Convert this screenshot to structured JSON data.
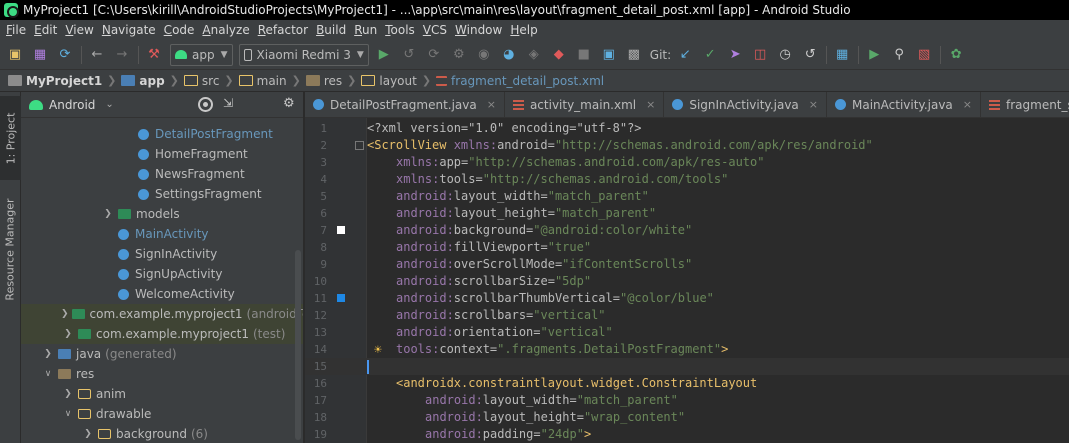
{
  "window": {
    "title": "MyProject1 [C:\\Users\\kirill\\AndroidStudioProjects\\MyProject1] - ...\\app\\src\\main\\res\\layout\\fragment_detail_post.xml [app] - Android Studio"
  },
  "menu": [
    "File",
    "Edit",
    "View",
    "Navigate",
    "Code",
    "Analyze",
    "Refactor",
    "Build",
    "Run",
    "Tools",
    "VCS",
    "Window",
    "Help"
  ],
  "toolbar": {
    "config": "app",
    "device": "Xiaomi Redmi 3",
    "git_label": "Git:"
  },
  "breadcrumb": [
    "MyProject1",
    "app",
    "src",
    "main",
    "res",
    "layout",
    "fragment_detail_post.xml"
  ],
  "side_tabs": {
    "project": "1: Project",
    "resource_manager": "Resource Manager"
  },
  "project_panel": {
    "view": "Android",
    "tree": [
      {
        "label": "DetailPostFragment",
        "icon": "kotlin-class-icon",
        "color": "#6897bb",
        "indent": 100
      },
      {
        "label": "HomeFragment",
        "icon": "kotlin-class-icon",
        "indent": 100
      },
      {
        "label": "NewsFragment",
        "icon": "kotlin-class-icon",
        "indent": 100
      },
      {
        "label": "SettingsFragment",
        "icon": "kotlin-class-icon",
        "indent": 100
      },
      {
        "label": "models",
        "icon": "package-folder-icon",
        "indent": 80,
        "arrow": "right"
      },
      {
        "label": "MainActivity",
        "icon": "kotlin-class-icon",
        "color": "#6897bb",
        "indent": 80
      },
      {
        "label": "SignInActivity",
        "icon": "kotlin-class-icon",
        "indent": 80
      },
      {
        "label": "SignUpActivity",
        "icon": "kotlin-class-icon",
        "indent": 80
      },
      {
        "label": "WelcomeActivity",
        "icon": "kotlin-class-icon",
        "indent": 80
      },
      {
        "label": "com.example.myproject1",
        "suffix": "(androidTest)",
        "icon": "package-folder-icon",
        "indent": 40,
        "arrow": "right",
        "highlight": true
      },
      {
        "label": "com.example.myproject1",
        "suffix": "(test)",
        "icon": "package-folder-icon",
        "indent": 40,
        "arrow": "right",
        "highlight": true
      },
      {
        "label": "java",
        "suffix": "(generated)",
        "icon": "generated-folder-icon",
        "indent": 20,
        "arrow": "right"
      },
      {
        "label": "res",
        "icon": "res-folder-icon",
        "indent": 20,
        "arrow": "down"
      },
      {
        "label": "anim",
        "icon": "folder-icon",
        "indent": 40,
        "arrow": "right"
      },
      {
        "label": "drawable",
        "icon": "folder-icon",
        "indent": 40,
        "arrow": "down"
      },
      {
        "label": "background",
        "suffix": "(6)",
        "icon": "folder-icon",
        "indent": 60,
        "arrow": "right"
      }
    ]
  },
  "tabs": [
    {
      "label": "DetailPostFragment.java",
      "icon": "kt"
    },
    {
      "label": "activity_main.xml",
      "icon": "xml"
    },
    {
      "label": "SignInActivity.java",
      "icon": "kt"
    },
    {
      "label": "MainActivity.java",
      "icon": "kt"
    },
    {
      "label": "fragment_settings.xml",
      "icon": "xml"
    }
  ],
  "code": [
    {
      "n": "1",
      "indent": 0,
      "parts": [
        [
          "pi",
          "<?xml version=\"1.0\" encoding=\"utf-8\"?>"
        ]
      ]
    },
    {
      "n": "2",
      "indent": 0,
      "fold": true,
      "parts": [
        [
          "tag",
          "<ScrollView "
        ],
        [
          "ns",
          "xmlns:"
        ],
        [
          "attr",
          "android="
        ],
        [
          "val",
          "\"http://schemas.android.com/apk/res/android\""
        ]
      ]
    },
    {
      "n": "3",
      "indent": 4,
      "parts": [
        [
          "ns",
          "xmlns:"
        ],
        [
          "attr",
          "app="
        ],
        [
          "val",
          "\"http://schemas.android.com/apk/res-auto\""
        ]
      ]
    },
    {
      "n": "4",
      "indent": 4,
      "parts": [
        [
          "ns",
          "xmlns:"
        ],
        [
          "attr",
          "tools="
        ],
        [
          "val",
          "\"http://schemas.android.com/tools\""
        ]
      ]
    },
    {
      "n": "5",
      "indent": 4,
      "parts": [
        [
          "ns",
          "android:"
        ],
        [
          "attr",
          "layout_width="
        ],
        [
          "val",
          "\"match_parent\""
        ]
      ]
    },
    {
      "n": "6",
      "indent": 4,
      "parts": [
        [
          "ns",
          "android:"
        ],
        [
          "attr",
          "layout_height="
        ],
        [
          "val",
          "\"match_parent\""
        ]
      ]
    },
    {
      "n": "7",
      "indent": 4,
      "swatch": "#ffffff",
      "parts": [
        [
          "ns",
          "android:"
        ],
        [
          "attr",
          "background="
        ],
        [
          "val",
          "\"@android:color/white\""
        ]
      ]
    },
    {
      "n": "8",
      "indent": 4,
      "parts": [
        [
          "ns",
          "android:"
        ],
        [
          "attr",
          "fillViewport="
        ],
        [
          "val",
          "\"true\""
        ]
      ]
    },
    {
      "n": "9",
      "indent": 4,
      "parts": [
        [
          "ns",
          "android:"
        ],
        [
          "attr",
          "overScrollMode="
        ],
        [
          "val",
          "\"ifContentScrolls\""
        ]
      ]
    },
    {
      "n": "10",
      "indent": 4,
      "parts": [
        [
          "ns",
          "android:"
        ],
        [
          "attr",
          "scrollbarSize="
        ],
        [
          "val",
          "\"5dp\""
        ]
      ]
    },
    {
      "n": "11",
      "indent": 4,
      "swatch": "#1e88e5",
      "parts": [
        [
          "ns",
          "android:"
        ],
        [
          "attr",
          "scrollbarThumbVertical="
        ],
        [
          "val",
          "\"@color/blue\""
        ]
      ]
    },
    {
      "n": "12",
      "indent": 4,
      "parts": [
        [
          "ns",
          "android:"
        ],
        [
          "attr",
          "scrollbars="
        ],
        [
          "val",
          "\"vertical\""
        ]
      ]
    },
    {
      "n": "13",
      "indent": 4,
      "parts": [
        [
          "ns",
          "android:"
        ],
        [
          "attr",
          "orientation="
        ],
        [
          "val",
          "\"vertical\""
        ]
      ]
    },
    {
      "n": "14",
      "indent": 4,
      "bulb": true,
      "parts": [
        [
          "ns",
          "tools:"
        ],
        [
          "attr",
          "context="
        ],
        [
          "val",
          "\".fragments.DetailPostFragment\""
        ],
        [
          "tag",
          ">"
        ]
      ]
    },
    {
      "n": "15",
      "indent": 0,
      "current": true,
      "parts": []
    },
    {
      "n": "16",
      "indent": 4,
      "parts": [
        [
          "tag",
          "<androidx.constraintlayout.widget.ConstraintLayout"
        ]
      ]
    },
    {
      "n": "17",
      "indent": 8,
      "parts": [
        [
          "ns",
          "android:"
        ],
        [
          "attr",
          "layout_width="
        ],
        [
          "val",
          "\"match_parent\""
        ]
      ]
    },
    {
      "n": "18",
      "indent": 8,
      "parts": [
        [
          "ns",
          "android:"
        ],
        [
          "attr",
          "layout_height="
        ],
        [
          "val",
          "\"wrap_content\""
        ]
      ]
    },
    {
      "n": "19",
      "indent": 8,
      "parts": [
        [
          "ns",
          "android:"
        ],
        [
          "attr",
          "padding="
        ],
        [
          "val",
          "\"24dp\""
        ],
        [
          "tag",
          ">"
        ]
      ]
    }
  ]
}
